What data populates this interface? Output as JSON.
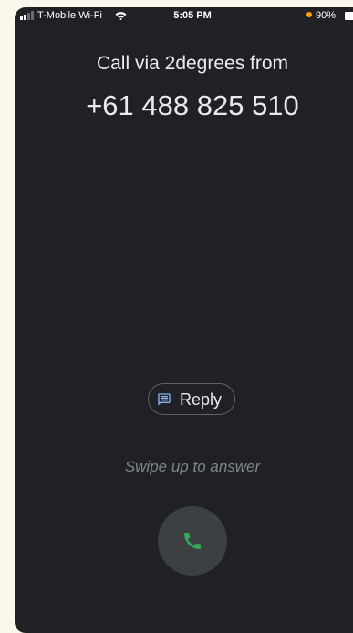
{
  "status_bar": {
    "carrier": "T-Mobile Wi-Fi",
    "time": "5:05 PM",
    "battery_percent": "90%",
    "signal_bars": 2,
    "signal_bars_total": 4,
    "low_power_color": "#ff9f0a"
  },
  "call": {
    "title": "Call via 2degrees from",
    "number": "+61 488 825 510"
  },
  "actions": {
    "reply_label": "Reply",
    "reply_icon": "message-icon",
    "swipe_hint": "Swipe up to answer",
    "answer_icon": "phone-icon",
    "answer_color": "#34a853"
  },
  "colors": {
    "background": "#202124",
    "text": "#e8eaed",
    "muted_text": "#80868b",
    "answer_button_bg": "#3c4043"
  }
}
